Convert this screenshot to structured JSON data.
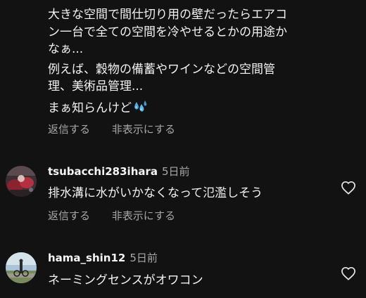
{
  "parent_comment": {
    "paragraph_1": "大きな空間で間仕切り用の壁だったらエアコ\nン一台で全ての空間を冷やせるとかの用途か\nなぁ...",
    "paragraph_2": "例えば、穀物の備蓄やワインなどの空間管\n理、美術品管理...",
    "paragraph_3": "まぁ知らんけど",
    "emoji": "sweat-droplets-icon"
  },
  "actions": {
    "reply": "返信する",
    "hide": "非表示にする"
  },
  "comments": [
    {
      "username": "tsubacchi283ihara",
      "time": "5日前",
      "text": "排水溝に水がいかなくなって氾濫しそう",
      "reply": "返信する",
      "hide": "非表示にする"
    },
    {
      "username": "hama_shin12",
      "time": "5日前",
      "text": "ネーミングセンスがオワコン"
    }
  ]
}
